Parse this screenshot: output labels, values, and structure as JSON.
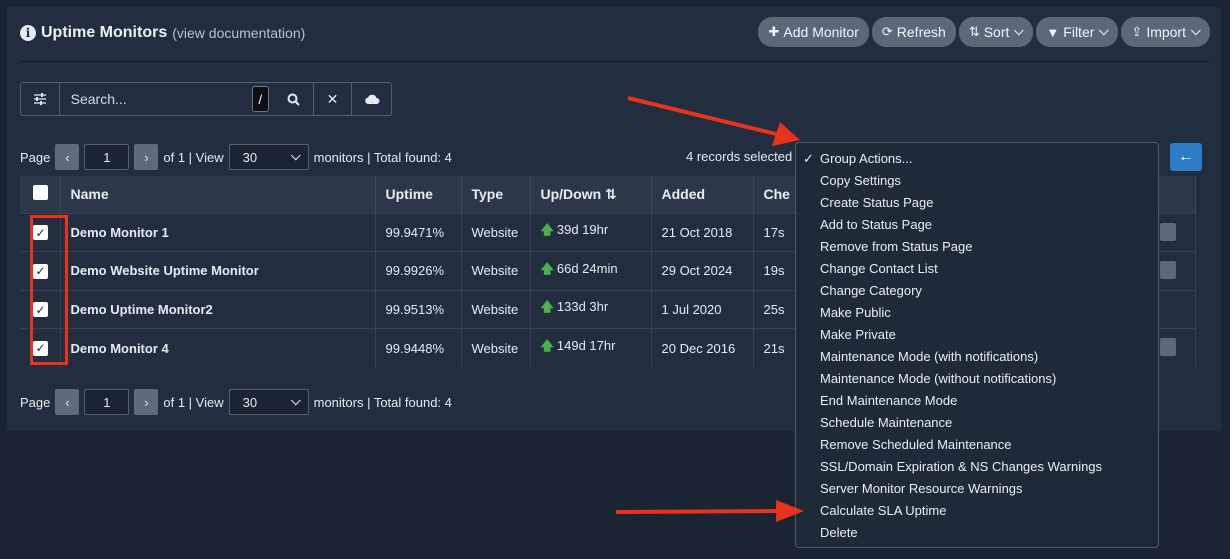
{
  "header": {
    "title": "Uptime Monitors",
    "doc_link": "(view documentation)"
  },
  "toolbar": {
    "add_monitor": "Add Monitor",
    "refresh": "Refresh",
    "sort": "Sort",
    "filter": "Filter",
    "import": "Import"
  },
  "search": {
    "placeholder": "Search...",
    "shortcut": "/"
  },
  "pager": {
    "page_label": "Page",
    "page": "1",
    "of_text": "of 1 | View",
    "view_count": "30",
    "summary": "monitors | Total found: 4"
  },
  "selection": {
    "text": "4 records selected"
  },
  "table": {
    "headers": {
      "name": "Name",
      "uptime": "Uptime",
      "type": "Type",
      "updown": "Up/Down",
      "added": "Added",
      "check": "Che"
    },
    "rows": [
      {
        "name": "Demo Monitor 1",
        "uptime": "99.9471%",
        "type": "Website",
        "updown": "39d 19hr",
        "added": "21 Oct 2018",
        "check": "17s"
      },
      {
        "name": "Demo Website Uptime Monitor",
        "uptime": "99.9926%",
        "type": "Website",
        "updown": "66d 24min",
        "added": "29 Oct 2024",
        "check": "19s"
      },
      {
        "name": "Demo Uptime Monitor2",
        "uptime": "99.9513%",
        "type": "Website",
        "updown": "133d 3hr",
        "added": "1 Jul 2020",
        "check": "25s"
      },
      {
        "name": "Demo Monitor 4",
        "uptime": "99.9448%",
        "type": "Website",
        "updown": "149d 17hr",
        "added": "20 Dec 2016",
        "check": "21s"
      }
    ]
  },
  "group_menu": {
    "items": [
      "Group Actions...",
      "Copy Settings",
      "Create Status Page",
      "Add to Status Page",
      "Remove from Status Page",
      "Change Contact List",
      "Change Category",
      "Make Public",
      "Make Private",
      "Maintenance Mode (with notifications)",
      "Maintenance Mode (without notifications)",
      "End Maintenance Mode",
      "Schedule Maintenance",
      "Remove Scheduled Maintenance",
      "SSL/Domain Expiration & NS Changes Warnings",
      "Server Monitor Resource Warnings",
      "Calculate SLA Uptime",
      "Delete"
    ]
  },
  "colors": {
    "accent": "#2f7cc6",
    "annotation": "#e8331c",
    "up": "#4caf50",
    "panel": "#222e3f"
  }
}
